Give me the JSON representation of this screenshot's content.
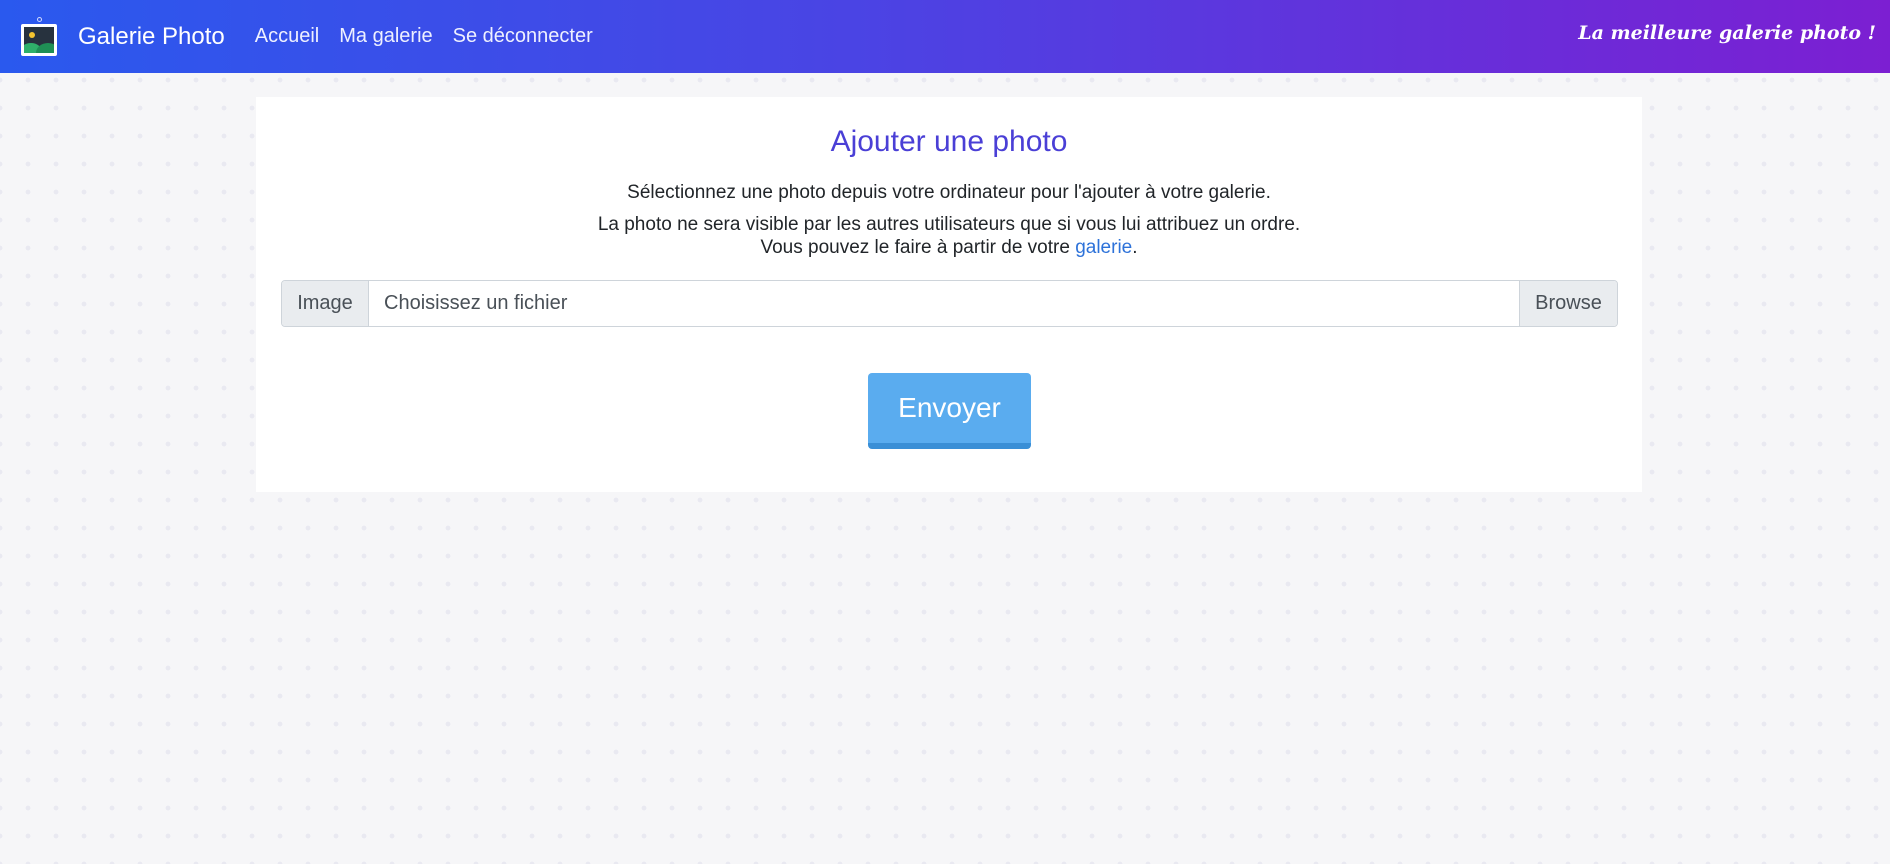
{
  "navbar": {
    "brand": "Galerie Photo",
    "links": [
      "Accueil",
      "Ma galerie",
      "Se déconnecter"
    ],
    "tagline": "La meilleure galerie photo !"
  },
  "card": {
    "title": "Ajouter une photo",
    "line1": "Sélectionnez une photo depuis votre ordinateur pour l'ajouter à votre galerie.",
    "line2": "La photo ne sera visible par les autres utilisateurs que si vous lui attribuez un ordre.",
    "line3_prefix": "Vous pouvez le faire à partir de votre ",
    "line3_link": "galerie",
    "line3_suffix": "."
  },
  "file_input": {
    "label": "Image",
    "placeholder": "Choisissez un fichier",
    "browse": "Browse"
  },
  "submit": {
    "label": "Envoyer"
  },
  "colors": {
    "navbar_start": "#2a59ee",
    "navbar_end": "#7c1fd2",
    "title": "#4a3fd6",
    "link": "#2d72d9",
    "button": "#5aacef"
  }
}
